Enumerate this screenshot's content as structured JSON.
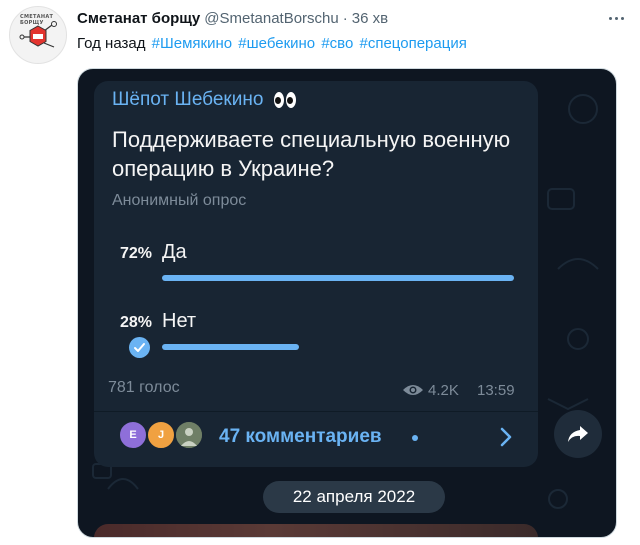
{
  "tweet": {
    "display_name": "Сметанат борщу",
    "handle": "@SmetanatBorschu",
    "separator": "·",
    "time": "36 хв",
    "avatar_brand": "СМЕТАНАТ БОРЩУ",
    "text_prefix": "Год назад",
    "hashtags": [
      "#Шемякино",
      "#шебекино",
      "#сво",
      "#спецоперация"
    ]
  },
  "telegram": {
    "channel_name": "Шёпот Шебекино",
    "poll": {
      "question": "Поддерживаете специальную военную операцию в Украине?",
      "type_label": "Анонимный опрос",
      "options": [
        {
          "label": "Да",
          "percent_label": "72%",
          "fraction": 0.72
        },
        {
          "label": "Нет",
          "percent_label": "28%",
          "fraction": 0.28,
          "selected": true
        }
      ],
      "votes_label": "781 голос"
    },
    "views": "4.2K",
    "time": "13:59",
    "comments": {
      "avatars": [
        {
          "letter": "E",
          "color": "#8e6fd9"
        },
        {
          "letter": "J",
          "color": "#f0a141"
        }
      ],
      "label": "47 комментариев"
    },
    "date_label": "22 апреля 2022"
  },
  "colors": {
    "accent": "#6ab3f3",
    "chat_bg": "#0e1621",
    "bubble_bg": "#182533",
    "hashtag": "#1d9bf0"
  }
}
